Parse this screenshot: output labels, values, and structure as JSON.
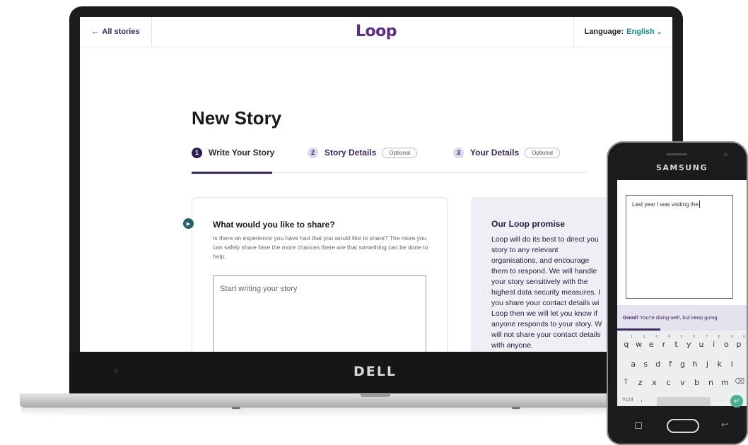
{
  "web": {
    "back_link": "All stories",
    "brand": "Loop",
    "language_label": "Language:",
    "language_value": "English",
    "page_title": "New Story",
    "steps": [
      {
        "num": "1",
        "label": "Write Your Story",
        "badge": ""
      },
      {
        "num": "2",
        "label": "Story Details",
        "badge": "Optional"
      },
      {
        "num": "3",
        "label": "Your Details",
        "badge": "Optional"
      }
    ],
    "share_title": "What would you like to share?",
    "share_desc": "Is there an experience you have had that you would like to share? The more you can safely share here the more chances there are that something can be done to help.",
    "story_placeholder": "Start writing your story",
    "promise_title": "Our Loop promise",
    "promise_lines": [
      "Loop will do its best to direct you",
      "story to any relevant",
      "organisations, and encourage",
      "them to respond. We will handle",
      "your story sensitively with the",
      "highest data security measures. I",
      "you share your contact details wi",
      "Loop then we will let you know if",
      "anyone responds to your story. W",
      "will not share your contact details",
      "with anyone."
    ]
  },
  "laptop_brand": "DELL",
  "phone": {
    "brand": "SAMSUNG",
    "typed_text": "Last year I was visiting the",
    "feedback_strong": "Good!",
    "feedback_text": "You're doing well, but keep going",
    "progress_fraction": 0.33,
    "keyboard": {
      "row1": [
        {
          "key": "q",
          "sup": "1"
        },
        {
          "key": "w",
          "sup": "2"
        },
        {
          "key": "e",
          "sup": "3"
        },
        {
          "key": "r",
          "sup": "4"
        },
        {
          "key": "t",
          "sup": "5"
        },
        {
          "key": "y",
          "sup": "6"
        },
        {
          "key": "u",
          "sup": "7"
        },
        {
          "key": "i",
          "sup": "8"
        },
        {
          "key": "o",
          "sup": "9"
        },
        {
          "key": "p",
          "sup": "0"
        }
      ],
      "row2": [
        "a",
        "s",
        "d",
        "f",
        "g",
        "h",
        "j",
        "k",
        "l"
      ],
      "row3": [
        "z",
        "x",
        "c",
        "v",
        "b",
        "n",
        "m"
      ],
      "mode_key": "?123",
      "comma_key": ",",
      "period_key": "."
    }
  },
  "colors": {
    "brand_purple": "#5b2d86",
    "accent_teal": "#1a8a88",
    "dark_purple": "#3c2a5c",
    "promise_bg": "#f1eff6"
  },
  "icons": {
    "back": "arrow-left-icon",
    "chevron": "chevron-down-icon",
    "play": "play-icon",
    "enter": "enter-icon",
    "shift": "shift-icon",
    "backspace": "backspace-icon"
  }
}
